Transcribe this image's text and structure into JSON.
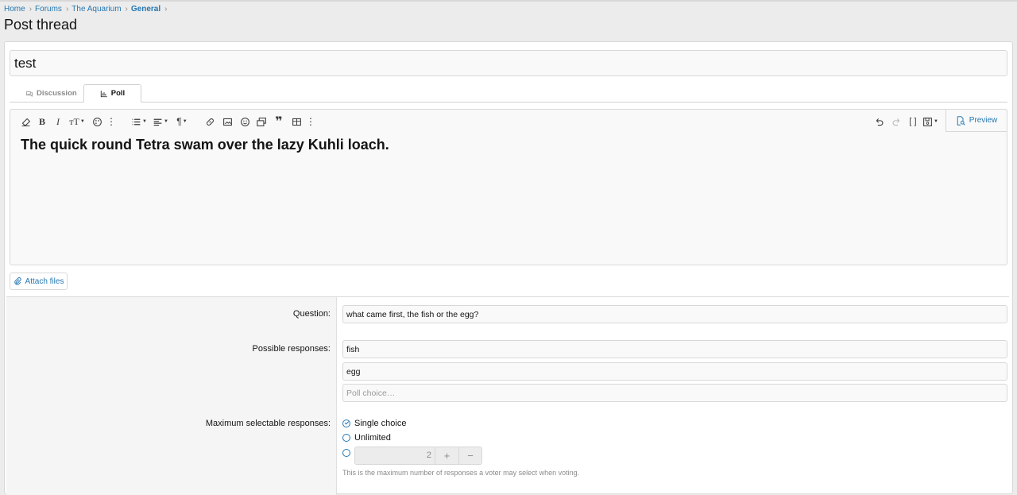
{
  "breadcrumb": [
    "Home",
    "Forums",
    "The Aquarium",
    "General"
  ],
  "page_title": "Post thread",
  "thread_title": "test",
  "tabs": {
    "discussion": "Discussion",
    "poll": "Poll"
  },
  "editor": {
    "content": "The quick round Tetra swam over the lazy Kuhli loach.",
    "preview_label": "Preview"
  },
  "attach_label": "Attach files",
  "poll": {
    "question_label": "Question:",
    "question_value": "what came first, the fish or the egg?",
    "responses_label": "Possible responses:",
    "responses": [
      "fish",
      "egg"
    ],
    "response_placeholder": "Poll choice…",
    "max_label": "Maximum selectable responses:",
    "options": [
      "Single choice",
      "Unlimited"
    ],
    "selected_option": "Single choice",
    "max_value": "2",
    "plus": "+",
    "minus": "−",
    "hint": "This is the maximum number of responses a voter may select when voting."
  },
  "colors": {
    "link": "#2577b1",
    "background": "#ececec"
  }
}
